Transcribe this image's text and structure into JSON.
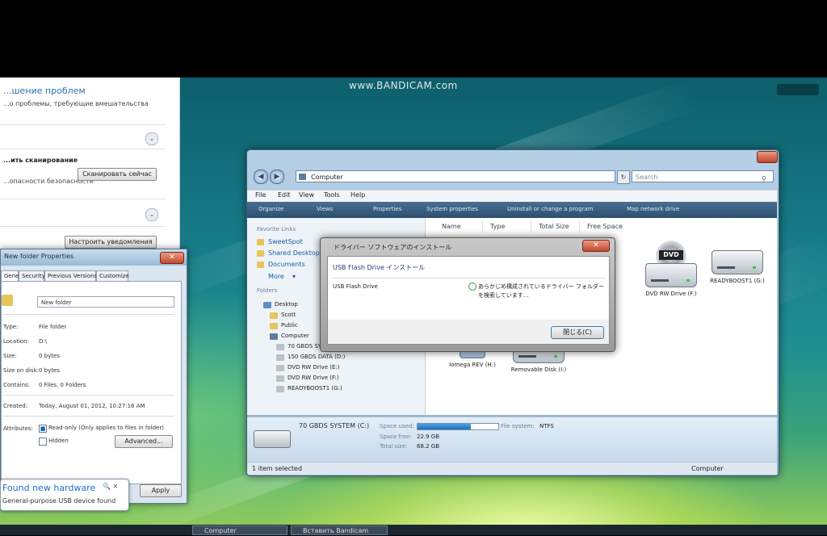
{
  "overlay": {
    "watermark": "www.BANDICAM.com"
  },
  "left_panel": {
    "title": "...шение проблем",
    "subtitle": "...о проблемы, требующие вмешательства",
    "scan_heading": "...ить сканирование",
    "scan_text": "...опасности безопасности",
    "scan_button": "Сканировать сейчас",
    "settings_button": "Настроить уведомления"
  },
  "properties": {
    "title": "New folder Properties",
    "tabs": [
      "General",
      "Security",
      "Previous Versions",
      "Customize"
    ],
    "name_value": "New folder",
    "rows": [
      {
        "label": "Type:",
        "value": "File folder"
      },
      {
        "label": "Location:",
        "value": "D:\\"
      },
      {
        "label": "Size:",
        "value": "0 bytes"
      },
      {
        "label": "Size on disk:",
        "value": "0 bytes"
      },
      {
        "label": "Contains:",
        "value": "0 Files, 0 Folders"
      },
      {
        "label": "Created:",
        "value": "Today, August 01, 2012, 10:27:16 AM"
      }
    ],
    "attributes_label": "Attributes:",
    "readonly_label": "Read-only (Only applies to files in folder)",
    "hidden_label": "Hidden",
    "advanced_button": "Advanced...",
    "apply_button": "Apply"
  },
  "balloon": {
    "title": "Found new hardware",
    "text": "General-purpose USB device found"
  },
  "explorer": {
    "address": "Computer",
    "search_placeholder": "Search",
    "menu": [
      "File",
      "Edit",
      "View",
      "Tools",
      "Help"
    ],
    "toolbar": [
      "Organize",
      "Views",
      "Properties",
      "System properties",
      "Uninstall or change a program",
      "Map network drive"
    ],
    "favorite_links_heading": "Favorite Links",
    "favorites": [
      "SweetSpot",
      "Shared Desktop",
      "Documents",
      "More"
    ],
    "folders_heading": "Folders",
    "tree": [
      "Desktop",
      "Scott",
      "Public",
      "Computer",
      "70 GBDS SYSTEM (C:)",
      "150 GBDS DATA (D:)",
      "DVD RW Drive (E:)",
      "DVD RW Drive (F:)",
      "READYBOOST1 (G:)"
    ],
    "columns": [
      "Name",
      "Type",
      "Total Size",
      "Free Space"
    ],
    "drives": [
      {
        "name": "DVD RW Drive (F:)"
      },
      {
        "name": "READYBOOST1 (G:)"
      },
      {
        "name": "Iomega REV (H:)"
      },
      {
        "name": "Removable Disk (I:)"
      }
    ],
    "details": {
      "name": "70 GBDS SYSTEM (C:)",
      "space_used_label": "Space used:",
      "space_free_label": "Space free:",
      "space_free_value": "22.9 GB",
      "total_size_label": "Total size:",
      "total_size_value": "68.2 GB",
      "fs_label": "File system:",
      "fs_value": "NTFS",
      "used_fraction": 0.66
    },
    "status_left": "1 item selected",
    "status_right": "Computer"
  },
  "dialog": {
    "title": "ドライバー ソフトウェアのインストール",
    "heading": "USB Flash Drive インストール",
    "device": "USB Flash Drive",
    "message": "あらかじめ構成されているドライバー フォルダーを検索しています...",
    "close_button": "閉じる(C)"
  },
  "taskbar": {
    "items": [
      "Computer",
      "Вставить Bandicam"
    ]
  }
}
